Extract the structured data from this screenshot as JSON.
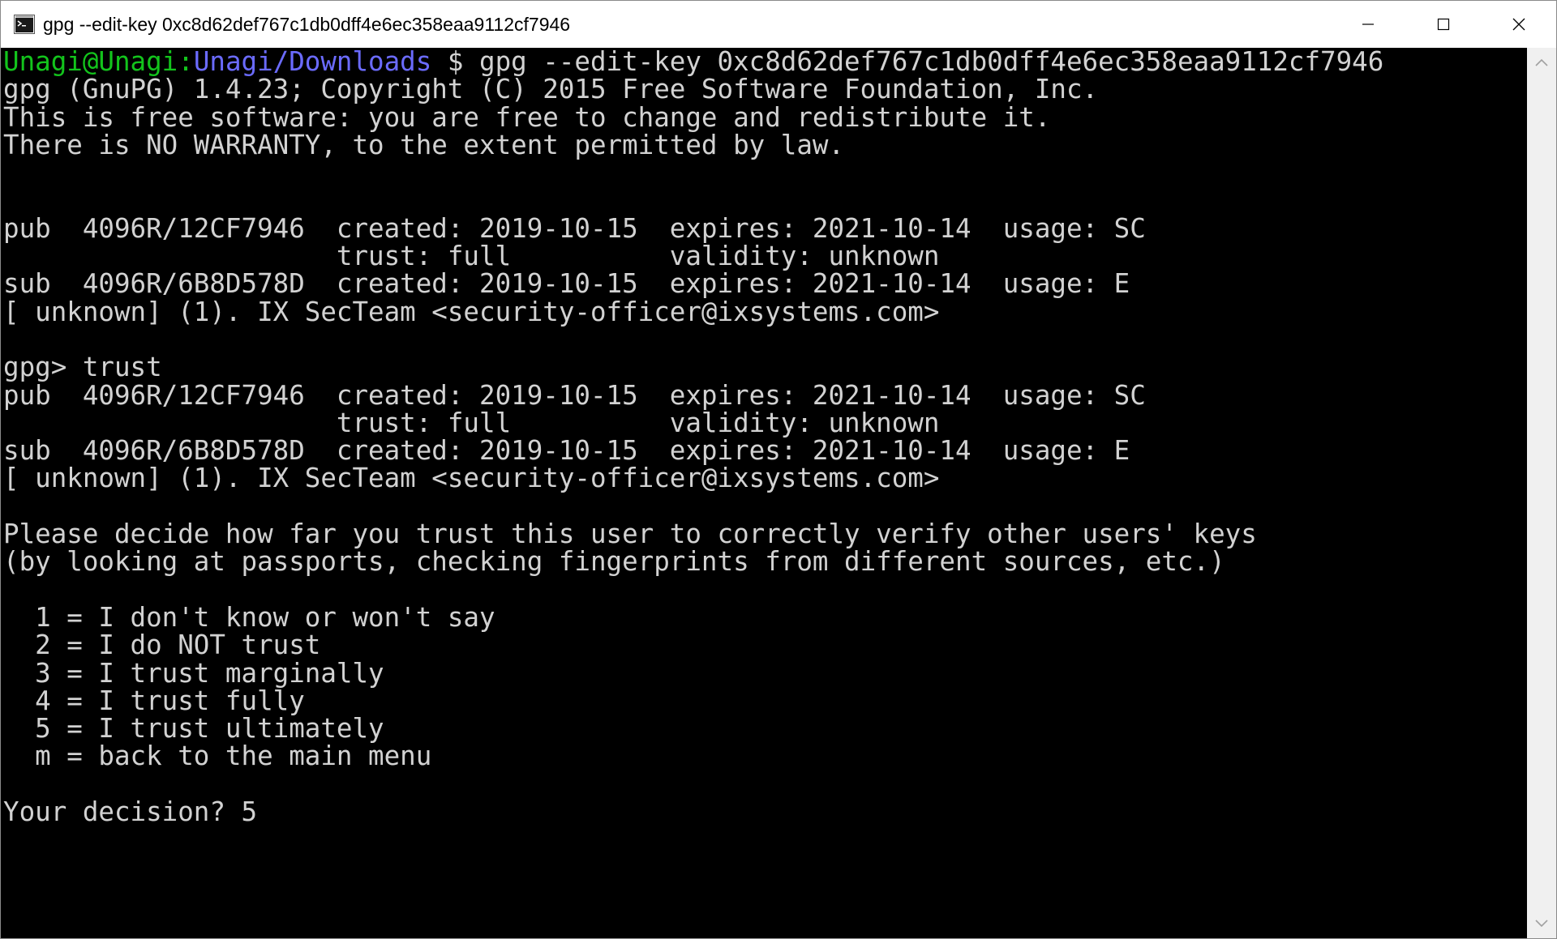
{
  "window": {
    "title": "gpg --edit-key 0xc8d62def767c1db0dff4e6ec358eaa9112cf7946",
    "app_icon": "console-icon",
    "controls": [
      "minimize-icon",
      "maximize-icon",
      "close-icon"
    ]
  },
  "terminal": {
    "colors": {
      "background": "#000000",
      "foreground": "#d2d2d2",
      "user_host": "#13c41c",
      "path": "#6b6bff"
    },
    "prompt": {
      "user_host": "Unagi@Unagi:",
      "path": "Unagi/Downloads",
      "command": " $ gpg --edit-key 0xc8d62def767c1db0dff4e6ec358eaa9112cf7946"
    },
    "lines": [
      "gpg (GnuPG) 1.4.23; Copyright (C) 2015 Free Software Foundation, Inc.",
      "This is free software: you are free to change and redistribute it.",
      "There is NO WARRANTY, to the extent permitted by law.",
      "",
      "",
      "pub  4096R/12CF7946  created: 2019-10-15  expires: 2021-10-14  usage: SC",
      "                     trust: full          validity: unknown",
      "sub  4096R/6B8D578D  created: 2019-10-15  expires: 2021-10-14  usage: E",
      "[ unknown] (1). IX SecTeam <security-officer@ixsystems.com>",
      "",
      "gpg> trust",
      "pub  4096R/12CF7946  created: 2019-10-15  expires: 2021-10-14  usage: SC",
      "                     trust: full          validity: unknown",
      "sub  4096R/6B8D578D  created: 2019-10-15  expires: 2021-10-14  usage: E",
      "[ unknown] (1). IX SecTeam <security-officer@ixsystems.com>",
      "",
      "Please decide how far you trust this user to correctly verify other users' keys",
      "(by looking at passports, checking fingerprints from different sources, etc.)",
      "",
      "  1 = I don't know or won't say",
      "  2 = I do NOT trust",
      "  3 = I trust marginally",
      "  4 = I trust fully",
      "  5 = I trust ultimately",
      "  m = back to the main menu",
      "",
      "Your decision? 5"
    ]
  },
  "scrollbar": {
    "up_icon": "scroll-up-arrow-icon",
    "down_icon": "scroll-down-arrow-icon",
    "position": 1.0
  }
}
